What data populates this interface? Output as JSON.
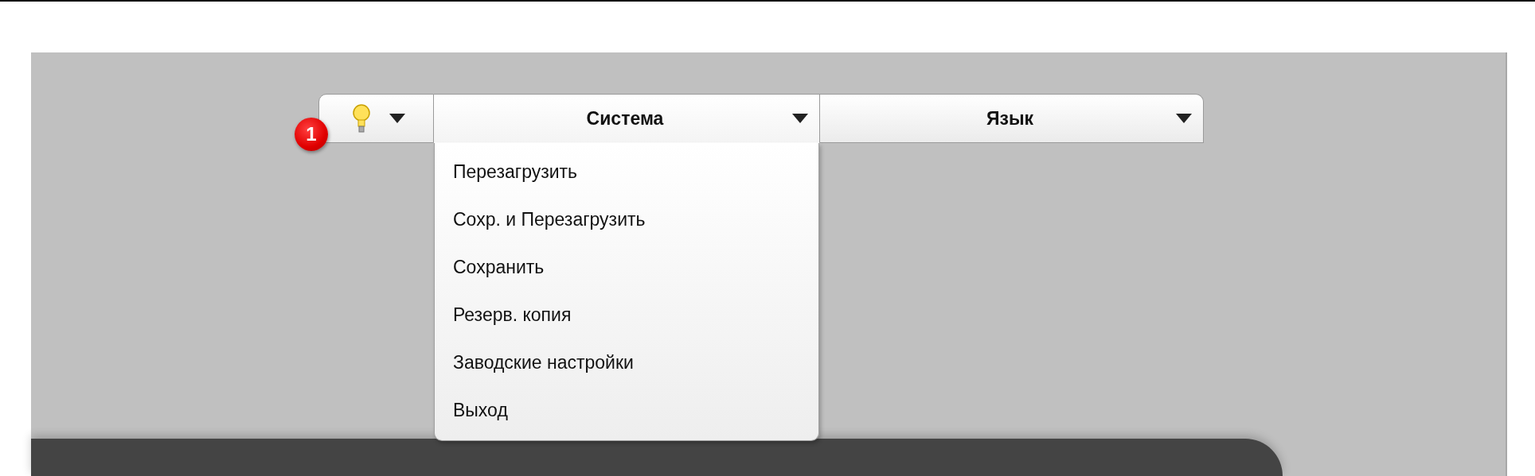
{
  "callout": {
    "label": "1"
  },
  "menubar": {
    "items": [
      {
        "kind": "icon",
        "expanded": false
      },
      {
        "kind": "text",
        "label": "Система",
        "expanded": true,
        "menu": [
          "Перезагрузить",
          "Сохр. и Перезагрузить",
          "Сохранить",
          "Резерв. копия",
          "Заводские настройки",
          "Выход"
        ]
      },
      {
        "kind": "text",
        "label": "Язык",
        "expanded": false
      }
    ]
  }
}
